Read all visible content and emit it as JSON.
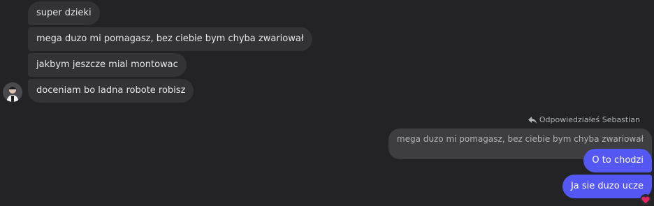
{
  "incoming": {
    "messages": [
      "super dzieki",
      "mega duzo mi pomagasz, bez ciebie bym chyba zwariował",
      "jakbym jeszcze mial montowac",
      "doceniam bo ladna robote robisz"
    ]
  },
  "reply": {
    "caption": "Odpowiedziałeś Sebastian",
    "quoted_text": "mega duzo mi pomagasz, bez ciebie bym chyba zwariował"
  },
  "outgoing": {
    "messages": [
      "O to chodzi",
      "Ja sie duzo ucze"
    ],
    "reaction_icon": "heart-icon",
    "reaction_color": "#e0245e"
  },
  "colors": {
    "background": "#232325",
    "incoming_bubble": "#333335",
    "outgoing_bubble": "#5457f2",
    "quoted_bubble": "#3e3e40"
  }
}
